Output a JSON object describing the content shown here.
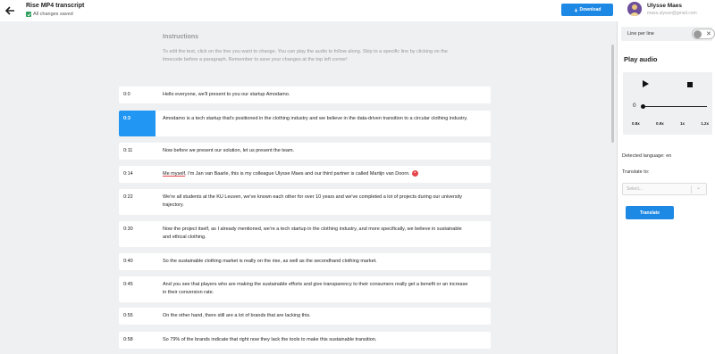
{
  "header": {
    "title": "Rise MP4 transcript",
    "saved_status": "All changes saved",
    "download_label": "Download",
    "user_name": "Ulysse Maes",
    "user_email": "maes.ulysse@gmail.com"
  },
  "instructions": {
    "title": "Instructions",
    "text": "To edit the text, click on the line you want to change. You can play the audio to follow along. Skip to a specific line by clicking on the timecode before a paragraph. Remember to save your changes at the top left corner!"
  },
  "transcript": [
    {
      "time": "0:0",
      "text": "Hello everyone, we'll present to you our startup Amodamo."
    },
    {
      "time": "0:3",
      "text": "Amodamo is a tech startup that's positioned in the clothing industry and we believe in the data-driven transition to a circular clothing industry."
    },
    {
      "time": "0:11",
      "text": "Now before we present our solution, let us present the team."
    },
    {
      "time": "0:14",
      "text_underlined": "Me myself",
      "text": ", I'm Jan van Baarle, this is my colleague Ulysse Maes and our third partner is called Martijn van Doorn."
    },
    {
      "time": "0:22",
      "text": "We're all students at the KU Leuven, we've known each other for over 10 years and we've completed a lot of projects during our university trajectory."
    },
    {
      "time": "0:30",
      "text": "Now the project itself, as I already mentioned, we're a tech startup in the clothing industry, and more specifically, we believe in sustainable and ethical clothing."
    },
    {
      "time": "0:40",
      "text": "So the sustainable clothing market is really on the rise, as well as the secondhand clothing market."
    },
    {
      "time": "0:45",
      "text": "And you see that players who are making the sustainable efforts and give transparency to their consumers really get a benefit or an increase in their conversion rate."
    },
    {
      "time": "0:55",
      "text": "On the other hand, there still are a lot of brands that are lacking this."
    },
    {
      "time": "0:58",
      "text": "So 79% of the brands indicate that right now they lack the tools to make this sustainable transition."
    }
  ],
  "panel": {
    "line_per_line_label": "Line per line",
    "play_audio_label": "Play audio",
    "position": "0",
    "speeds": [
      "0.8x",
      "0.9x",
      "1x",
      "1.2x"
    ],
    "detected_language": "Detected language: en",
    "translate_to_label": "Translate to:",
    "select_placeholder": "Select...",
    "translate_button": "Translate"
  },
  "colors": {
    "accent": "#1e88e5",
    "active_time": "#2196f3",
    "saved_check": "#2e9e5b",
    "error_dot": "#e5464a"
  }
}
